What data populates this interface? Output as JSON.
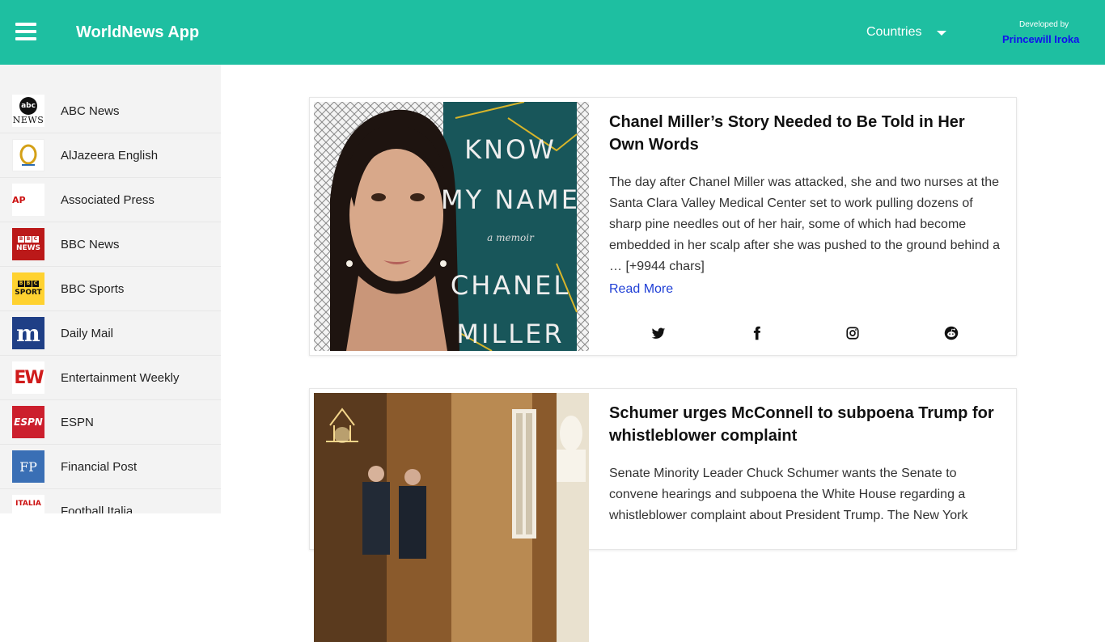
{
  "header": {
    "app_title": "WorldNews App",
    "countries_label": "Countries",
    "developed_by": "Developed by",
    "developer": "Princewill Iroka",
    "accent": "#1ebfa1"
  },
  "sidebar": {
    "items": [
      {
        "label": "ABC News",
        "logo": "abc-news-logo",
        "logo_text": "abc",
        "logo_sub": "NEWS"
      },
      {
        "label": "AlJazeera English",
        "logo": "aljazeera-logo"
      },
      {
        "label": "Associated Press",
        "logo": "ap-logo",
        "logo_text": "AP"
      },
      {
        "label": "BBC News",
        "logo": "bbc-news-logo",
        "logo_letters": [
          "B",
          "B",
          "C"
        ],
        "logo_sub": "NEWS"
      },
      {
        "label": "BBC Sports",
        "logo": "bbc-sport-logo",
        "logo_letters": [
          "B",
          "B",
          "C"
        ],
        "logo_sub": "SPORT"
      },
      {
        "label": "Daily Mail",
        "logo": "daily-mail-logo",
        "logo_text": "m"
      },
      {
        "label": "Entertainment Weekly",
        "logo": "ew-logo",
        "logo_text": "EW"
      },
      {
        "label": "ESPN",
        "logo": "espn-logo",
        "logo_text": "ESPN"
      },
      {
        "label": "Financial Post",
        "logo": "financial-post-logo",
        "logo_text": "FP"
      },
      {
        "label": "Football Italia",
        "logo": "football-italia-logo",
        "logo_text": "ITALIA"
      }
    ]
  },
  "articles": [
    {
      "title": "Chanel Miller’s Story Needed to Be Told in Her Own Words",
      "description": "The day after Chanel Miller was attacked, she and two nurses at the Santa Clara Valley Medical Center set to work pulling dozens of sharp pine needles out of her hair, some of which had become embedded in her scalp after she was pushed to the ground behind a … [+9944 chars]",
      "read_more": "Read More",
      "image": "chanel-miller-know-my-name-cover",
      "image_text": {
        "line1": "KNOW",
        "line2": "MY NAME",
        "line3": "a memoir",
        "line4": "CHANEL",
        "line5": "MILLER"
      }
    },
    {
      "title": "Schumer urges McConnell to subpoena Trump for whistleblower complaint",
      "description": "Senate Minority Leader Chuck Schumer wants the Senate to convene hearings and subpoena the White House regarding a whistleblower complaint about President Trump. The New York",
      "image": "capitol-hallway-photo"
    }
  ],
  "share_icons": [
    "twitter-icon",
    "facebook-icon",
    "instagram-icon",
    "reddit-icon"
  ]
}
